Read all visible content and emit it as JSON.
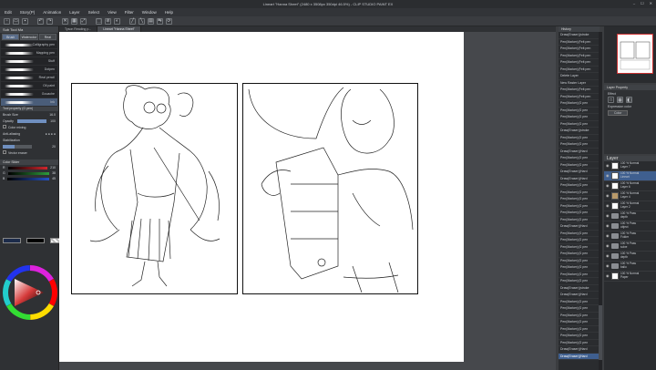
{
  "window": {
    "title": "Lineart \"Hanna Sheet\" (2480 x 3508px 350dpi 46.5%) - CLIP STUDIO PAINT EX",
    "controls": [
      "–",
      "☐",
      "✕"
    ]
  },
  "menu": [
    "Edit",
    "Story(P)",
    "Animation",
    "Layer",
    "Select",
    "View",
    "Filter",
    "Window",
    "Help"
  ],
  "toolbar": {
    "icons": [
      "new-icon",
      "open-icon",
      "save-icon",
      "undo-icon",
      "redo-icon",
      "clear-icon",
      "fill-icon",
      "transform-icon",
      "select-icon",
      "deselect-icon",
      "invert-icon",
      "snap-icon",
      "ruler-icon",
      "grid-icon",
      "flip-icon",
      "rotate-icon"
    ]
  },
  "sub_tool": {
    "header": "Sub Tool Ma",
    "tabs": [
      "Brush",
      "Watercolor",
      "Real"
    ],
    "brushes": [
      {
        "name": "Calligraphy pen"
      },
      {
        "name": "Mapping pen"
      },
      {
        "name": "Stuff"
      },
      {
        "name": "Dotpen"
      },
      {
        "name": "Real pencil"
      },
      {
        "name": "Oil paint"
      },
      {
        "name": "Gouache"
      },
      {
        "name": "Ink"
      }
    ],
    "selected_index": 7
  },
  "tool_property": {
    "header": "Tool property (G pen)",
    "brush_size_label": "Brush Size",
    "brush_size_value": "16.0",
    "opacity_label": "Opacity",
    "opacity_value": "100",
    "opacity_pct": 100,
    "color_mixing_label": "Color mixing",
    "antialiasing_label": "Anti-aliasing",
    "stabilization_label": "Stabilization",
    "stabilization_value": "20",
    "stabilization_pct": 40,
    "vectorize_label": "Vector eraser"
  },
  "color_slider": {
    "header": "Color Slider",
    "r": "210",
    "g": "38",
    "b": "45",
    "swatches": [
      "#1c2b4a",
      "#000000",
      "#ffffff"
    ],
    "red_track_color": "#d3262d",
    "green_track_color": "#2e9b3c",
    "blue_track_color": "#2452c8"
  },
  "color_wheel": {
    "header": "Color Wheel",
    "main_color": "#d63a3a"
  },
  "canvas": {
    "tabs": [
      "Tyson Reading p...",
      "Lineart \"Hanna Sheet\""
    ],
    "active_tab": 1
  },
  "history": {
    "header": "History",
    "items": [
      "Draw(Eraser)(stroke",
      "Pen(Marker)(Felt pen",
      "Pen(Marker)(Felt pen",
      "Pen(Marker)(Felt pen",
      "Pen(Marker)(Felt pen",
      "Pen(Marker)(Felt pen",
      "Delete Layer",
      "New Raster Layer",
      "Pen(Marker)(Felt pen",
      "Pen(Marker)(Felt pen",
      "Pen(Marker)(G pen",
      "Pen(Marker)(G pen",
      "Pen(Marker)(G pen",
      "Pen(Marker)(G pen",
      "Draw(Eraser)(stroke",
      "Pen(Marker)(G pen",
      "Pen(Marker)(G pen",
      "Draw(Eraser)(Hard",
      "Pen(Marker)(G pen",
      "Pen(Marker)(G pen",
      "Draw(Eraser)(Hard",
      "Draw(Eraser)(Hard",
      "Pen(Marker)(G pen",
      "Pen(Marker)(G pen",
      "Pen(Marker)(G pen",
      "Pen(Marker)(G pen",
      "Pen(Marker)(G pen",
      "Pen(Marker)(G pen",
      "Draw(Eraser)(Hard",
      "Pen(Marker)(G pen",
      "Pen(Marker)(G pen",
      "Pen(Marker)(G pen",
      "Pen(Marker)(G pen",
      "Pen(Marker)(G pen",
      "Pen(Marker)(G pen",
      "Pen(Marker)(G pen",
      "Pen(Marker)(G pen",
      "Draw(Eraser)(stroke",
      "Draw(Eraser)(Hard",
      "Pen(Marker)(G pen",
      "Pen(Marker)(G pen",
      "Pen(Marker)(G pen",
      "Pen(Marker)(G pen",
      "Pen(Marker)(G pen",
      "Pen(Marker)(G pen",
      "Pen(Marker)(G pen",
      "Draw(Eraser)(Hard",
      "Draw(Eraser)(Hard"
    ],
    "current_index": 47
  },
  "layer_property": {
    "header": "Layer Property",
    "effect_label": "Effect",
    "expression_label": "Expression color",
    "expression_value": "Color"
  },
  "layers": {
    "header": "Layer",
    "rows": [
      {
        "line1": "100 % Normal",
        "line2": "Layer 7",
        "kind": "thumb"
      },
      {
        "line1": "100 % Normal",
        "line2": "Lineart",
        "kind": "thumb",
        "current": true
      },
      {
        "line1": "100 % Normal",
        "line2": "Layer 6",
        "kind": "thumb"
      },
      {
        "line1": "100 % Normal",
        "line2": "Layer 4",
        "kind": "thumb"
      },
      {
        "line1": "100 % Normal",
        "line2": "Layer 2",
        "kind": "thumb"
      },
      {
        "line1": "100 % Pass",
        "line2": "depth",
        "kind": "folder"
      },
      {
        "line1": "100 % Pass",
        "line2": "object",
        "kind": "folder"
      },
      {
        "line1": "100 % Pass",
        "line2": "Folder",
        "kind": "folder"
      },
      {
        "line1": "100 % Pass",
        "line2": "solve",
        "kind": "folder"
      },
      {
        "line1": "100 % Pass",
        "line2": "depth",
        "kind": "folder"
      },
      {
        "line1": "100 % Pass",
        "line2": "ballo",
        "kind": "folder"
      },
      {
        "line1": "100 % Normal",
        "line2": "Paper",
        "kind": "thumb"
      }
    ]
  }
}
